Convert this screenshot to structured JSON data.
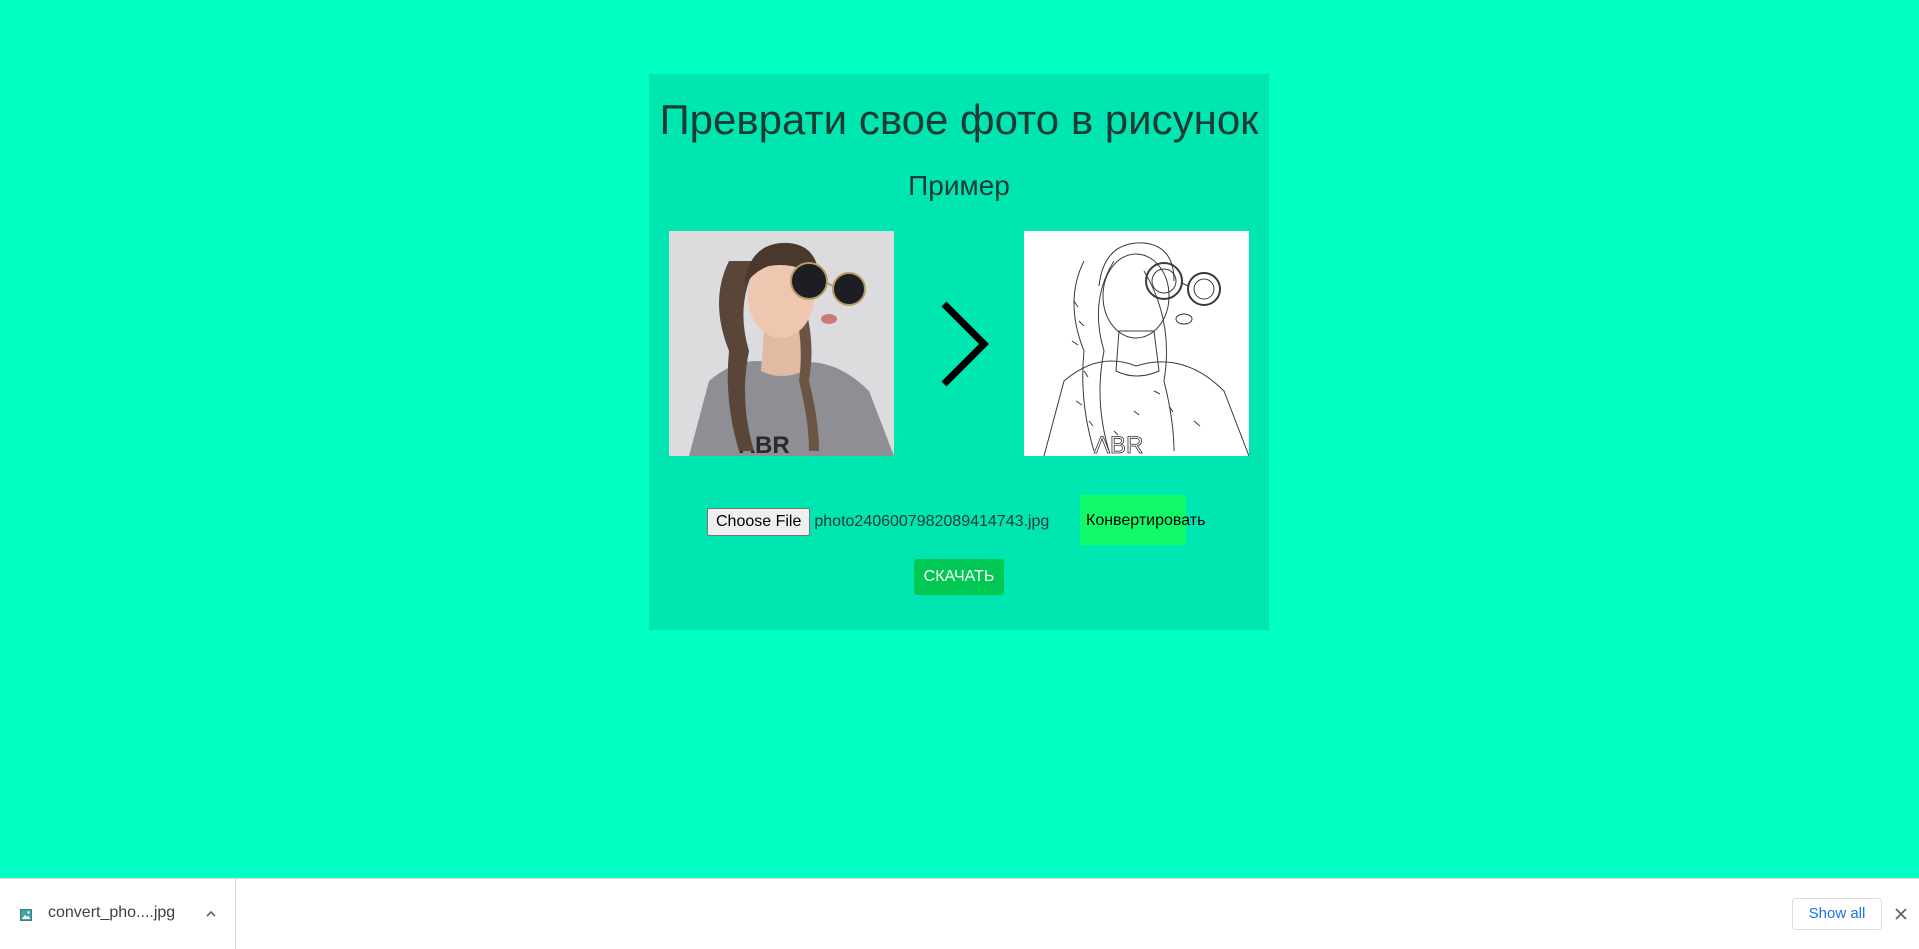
{
  "main": {
    "title": "Преврати свое фото в рисунок",
    "subtitle": "Пример",
    "choose_file_label": "Choose File",
    "selected_file": "photo2406007982089414743.jpg",
    "convert_label": "Конвертировать",
    "download_label": "СКАЧАТЬ"
  },
  "download_shelf": {
    "file_name": "convert_pho....jpg",
    "show_all_label": "Show all"
  },
  "colors": {
    "page_background": "#00ffc3",
    "card_background": "#00e6b0",
    "convert_button": "#11fa6a",
    "download_button": "#00c853",
    "link_blue": "#1a73e8"
  },
  "icons": {
    "arrow": "chevron-right-icon",
    "shelf_file": "image-file-icon",
    "shelf_expand": "chevron-up-icon",
    "shelf_close": "close-icon"
  }
}
